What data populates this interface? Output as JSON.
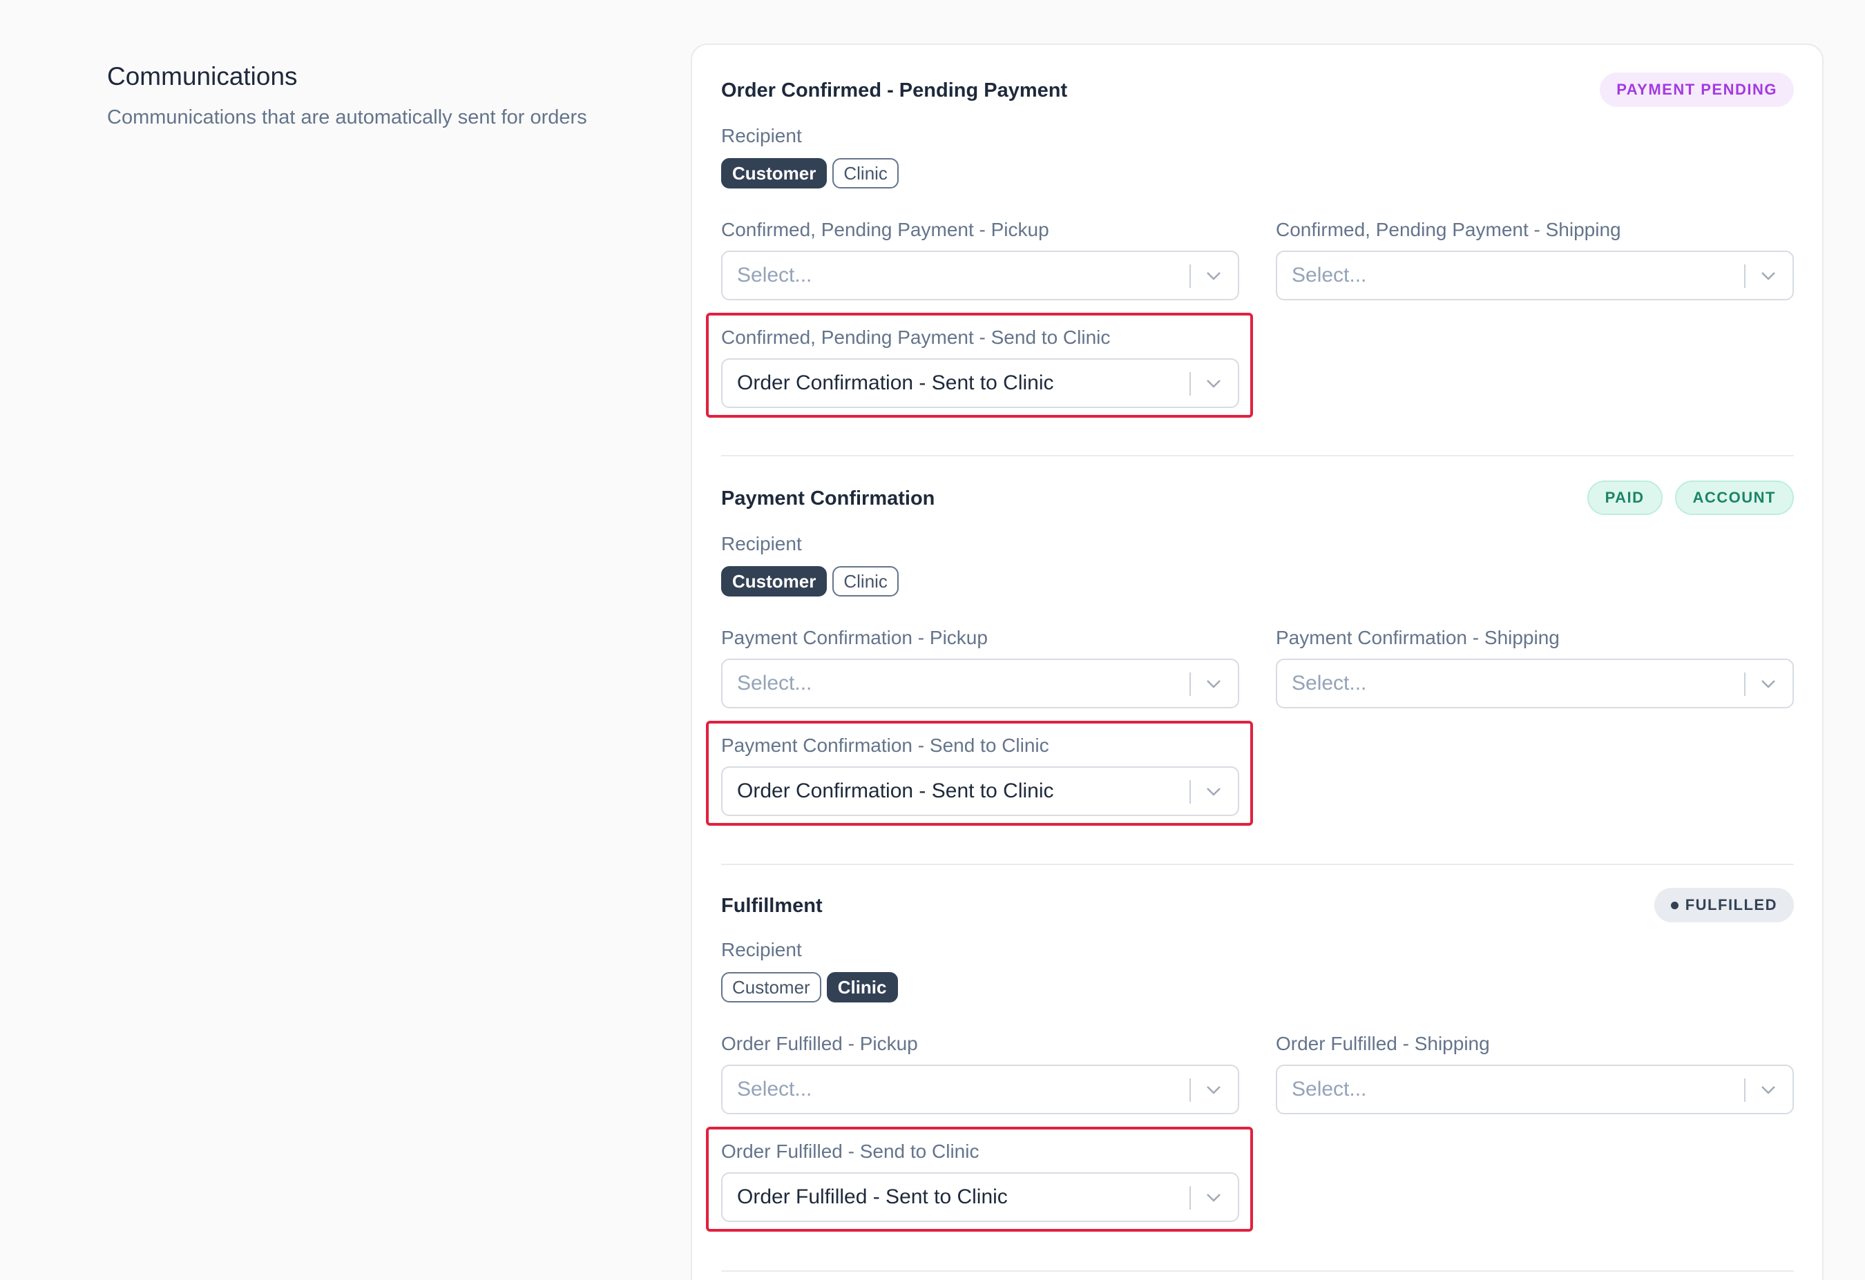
{
  "intro": {
    "title": "Communications",
    "description": "Communications that are automatically sent for orders"
  },
  "sections": [
    {
      "title": "Order Confirmed - Pending Payment",
      "badges": [
        "PAYMENT PENDING"
      ],
      "recipient_label": "Recipient",
      "recipients": [
        {
          "label": "Customer",
          "active": true
        },
        {
          "label": "Clinic",
          "active": false
        }
      ],
      "fields": [
        {
          "label": "Confirmed, Pending Payment - Pickup",
          "value": "Select...",
          "placeholder": true
        },
        {
          "label": "Confirmed, Pending Payment - Shipping",
          "value": "Select...",
          "placeholder": true
        },
        {
          "label": "Confirmed, Pending Payment - Send to Clinic",
          "value": "Order Confirmation - Sent to Clinic",
          "placeholder": false
        }
      ]
    },
    {
      "title": "Payment Confirmation",
      "badges": [
        "PAID",
        "ACCOUNT"
      ],
      "recipient_label": "Recipient",
      "recipients": [
        {
          "label": "Customer",
          "active": true
        },
        {
          "label": "Clinic",
          "active": false
        }
      ],
      "fields": [
        {
          "label": "Payment Confirmation - Pickup",
          "value": "Select...",
          "placeholder": true
        },
        {
          "label": "Payment Confirmation - Shipping",
          "value": "Select...",
          "placeholder": true
        },
        {
          "label": "Payment Confirmation - Send to Clinic",
          "value": "Order Confirmation - Sent to Clinic",
          "placeholder": false
        }
      ]
    },
    {
      "title": "Fulfillment",
      "badges": [
        "FULFILLED"
      ],
      "recipient_label": "Recipient",
      "recipients": [
        {
          "label": "Customer",
          "active": false
        },
        {
          "label": "Clinic",
          "active": true
        }
      ],
      "fields": [
        {
          "label": "Order Fulfilled - Pickup",
          "value": "Select...",
          "placeholder": true
        },
        {
          "label": "Order Fulfilled - Shipping",
          "value": "Select...",
          "placeholder": true
        },
        {
          "label": "Order Fulfilled - Send to Clinic",
          "value": "Order Fulfilled - Sent to Clinic",
          "placeholder": false
        }
      ]
    }
  ],
  "colors": {
    "highlight": "#e0213f",
    "active_pill": "#334155",
    "badge_purple_text": "#a43ae0",
    "badge_green_text": "#1c8566"
  }
}
